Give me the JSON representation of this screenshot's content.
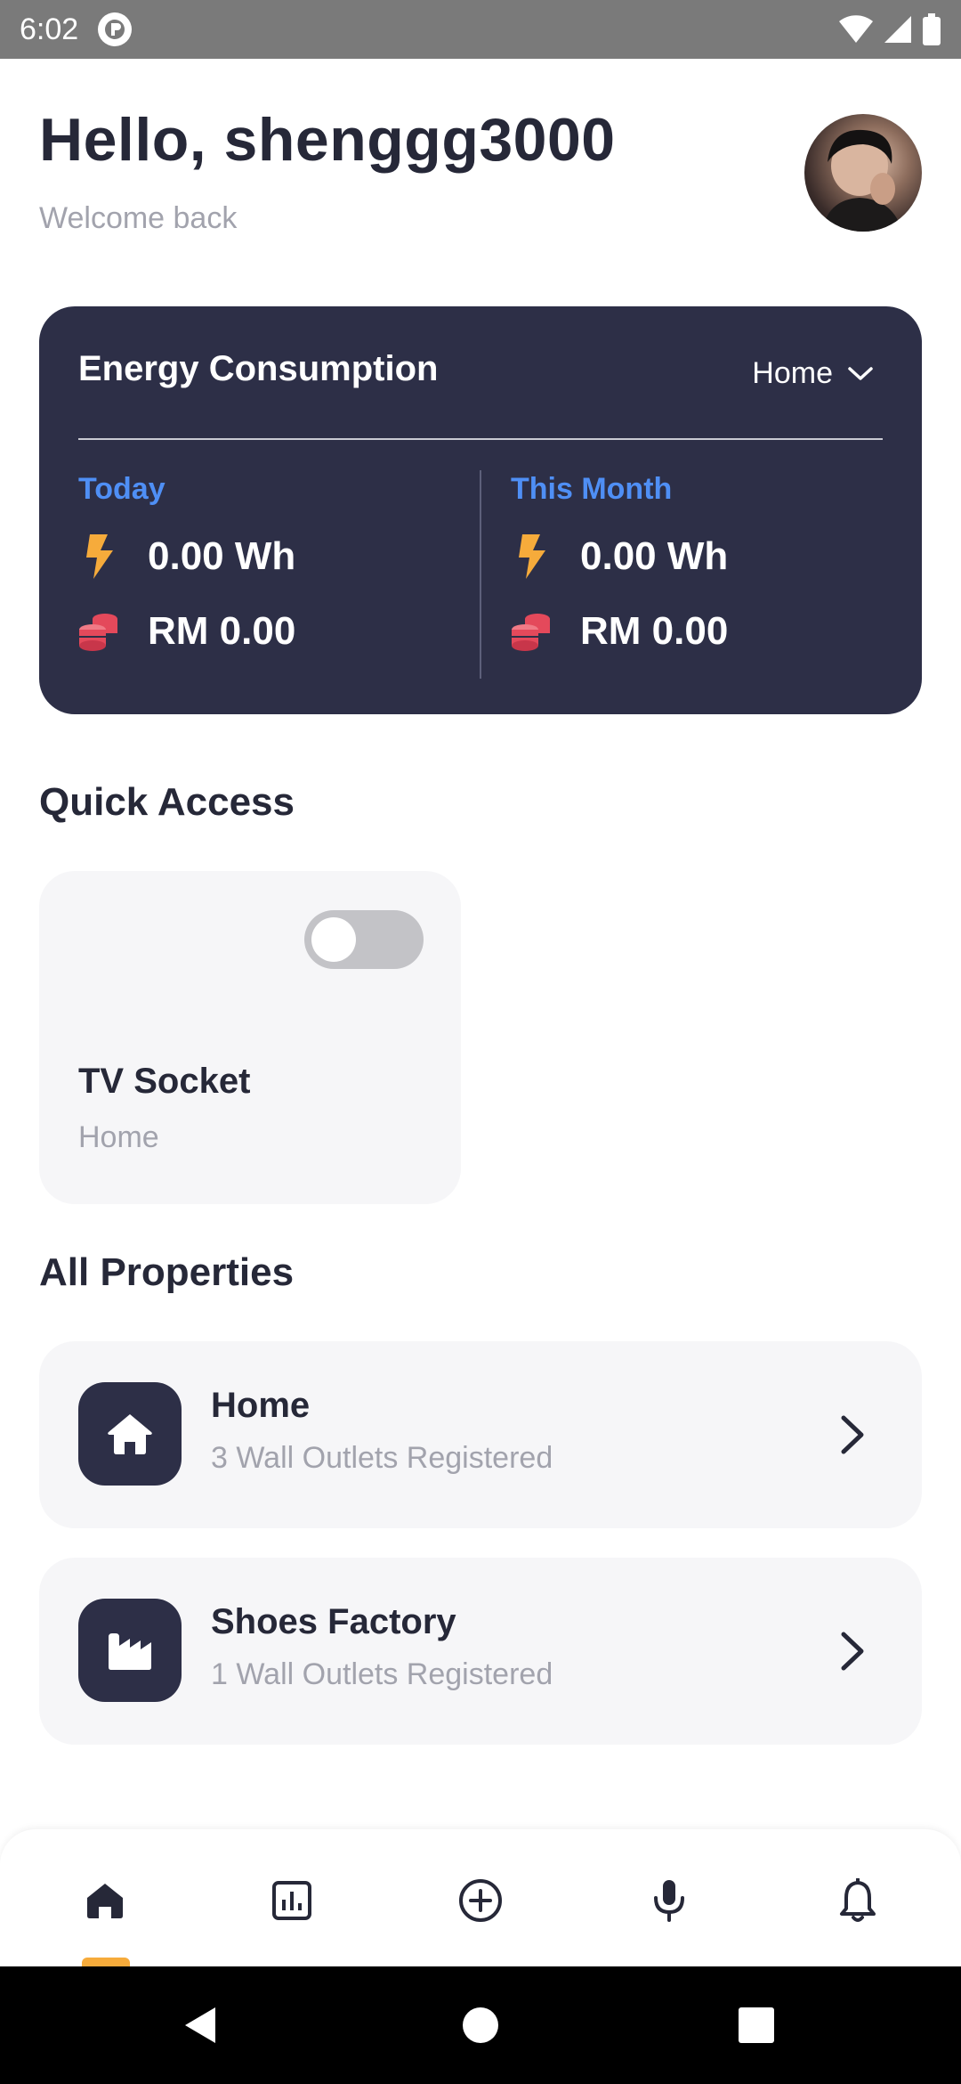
{
  "status_bar": {
    "time": "6:02",
    "icons": [
      "app-status-icon",
      "wifi-icon",
      "signal-icon",
      "battery-icon"
    ]
  },
  "header": {
    "greeting": "Hello, shenggg3000",
    "subtitle": "Welcome back",
    "avatar": "user-avatar"
  },
  "energy": {
    "title": "Energy Consumption",
    "property_select": "Home",
    "today": {
      "label": "Today",
      "energy": "0.00 Wh",
      "cost": "RM 0.00"
    },
    "month": {
      "label": "This Month",
      "energy": "0.00 Wh",
      "cost": "RM 0.00"
    }
  },
  "quick_access": {
    "title": "Quick Access",
    "device": {
      "name": "TV Socket",
      "property": "Home",
      "on": false
    }
  },
  "properties": {
    "title": "All Properties",
    "items": [
      {
        "name": "Home",
        "subtitle": "3 Wall Outlets Registered",
        "icon": "house-icon"
      },
      {
        "name": "Shoes Factory",
        "subtitle": "1 Wall Outlets Registered",
        "icon": "factory-icon"
      }
    ]
  },
  "bottom_nav": {
    "items": [
      "home-icon",
      "chart-icon",
      "add-circle-icon",
      "microphone-icon",
      "bell-icon"
    ],
    "active": "home-icon"
  },
  "colors": {
    "card_dark": "#2d2f47",
    "accent_blue": "#4f8ff5",
    "bolt_orange": "#f6ab3b",
    "coins_red": "#e4495b",
    "card_light": "#f6f6f8"
  }
}
